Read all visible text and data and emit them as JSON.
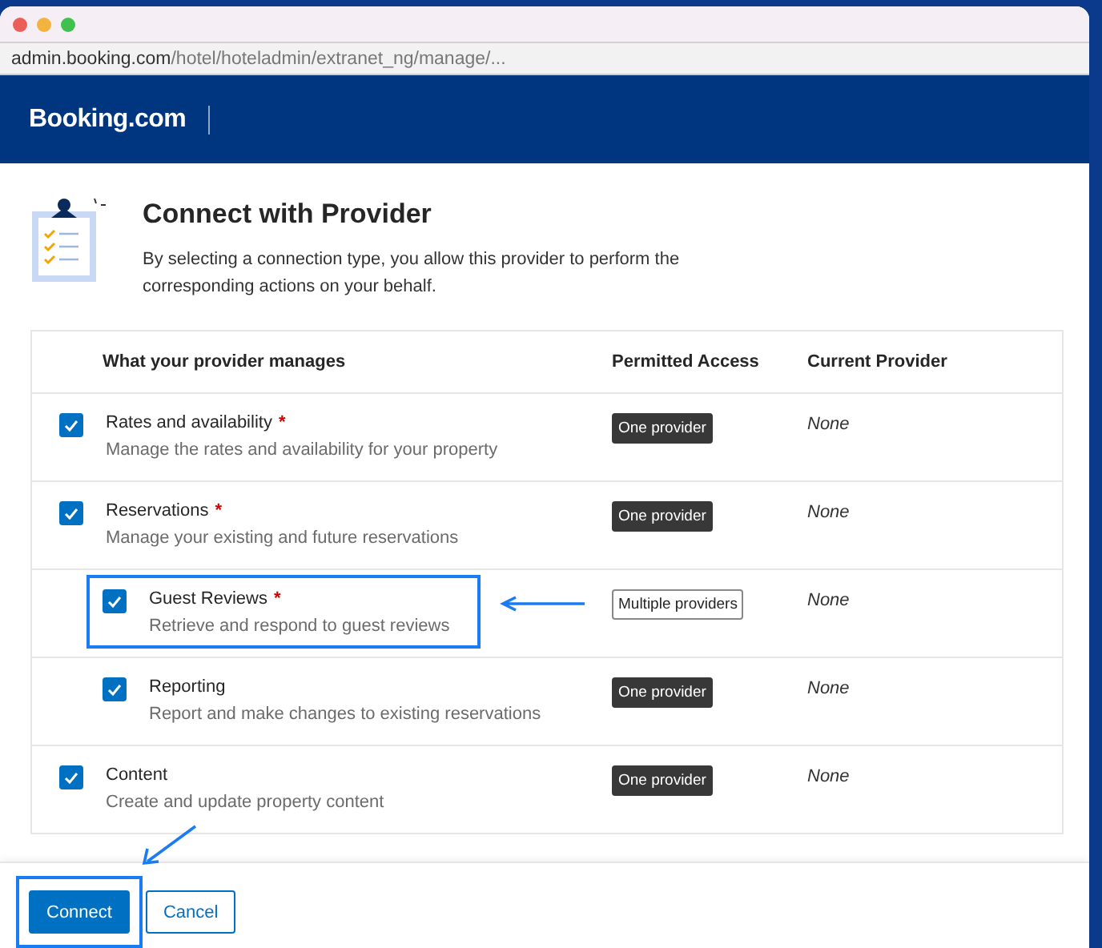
{
  "browser": {
    "url_host": "admin.booking.com",
    "url_path": "/hotel/hoteladmin/extranet_ng/manage/..."
  },
  "header": {
    "logo": "Booking.com"
  },
  "intro": {
    "title": "Connect with Provider",
    "description": "By selecting a connection type, you allow this provider to perform the corresponding actions on your behalf."
  },
  "table": {
    "columns": [
      "What your provider manages",
      "Permitted Access",
      "Current Provider"
    ],
    "rows": [
      {
        "title": "Rates and availability",
        "required_mark": "*",
        "description": "Manage the rates and availability for your property",
        "checked": true,
        "access": {
          "label": "One provider",
          "kind": "filled"
        },
        "provider": "None",
        "highlighted": false
      },
      {
        "title": "Reservations",
        "required_mark": "*",
        "description": "Manage your existing and future reservations",
        "checked": true,
        "access": {
          "label": "One provider",
          "kind": "filled"
        },
        "provider": "None",
        "highlighted": false,
        "children": [
          {
            "title": "Guest Reviews",
            "required_mark": "*",
            "description": "Retrieve and respond to guest reviews",
            "checked": true,
            "access": {
              "label": "Multiple providers",
              "kind": "outlined"
            },
            "provider": "None",
            "highlighted": true
          },
          {
            "title": "Reporting",
            "description": "Report and make changes to existing reservations",
            "checked": true,
            "access": {
              "label": "One provider",
              "kind": "filled"
            },
            "provider": "None",
            "highlighted": false
          }
        ]
      },
      {
        "title": "Content",
        "description": "Create and update property content",
        "checked": true,
        "access": {
          "label": "One provider",
          "kind": "filled"
        },
        "provider": "None",
        "highlighted": false
      }
    ]
  },
  "footer": {
    "buttons": [
      {
        "label": "Connect",
        "kind": "primary",
        "highlighted": true
      },
      {
        "label": "Cancel",
        "kind": "secondary",
        "highlighted": false
      }
    ]
  }
}
